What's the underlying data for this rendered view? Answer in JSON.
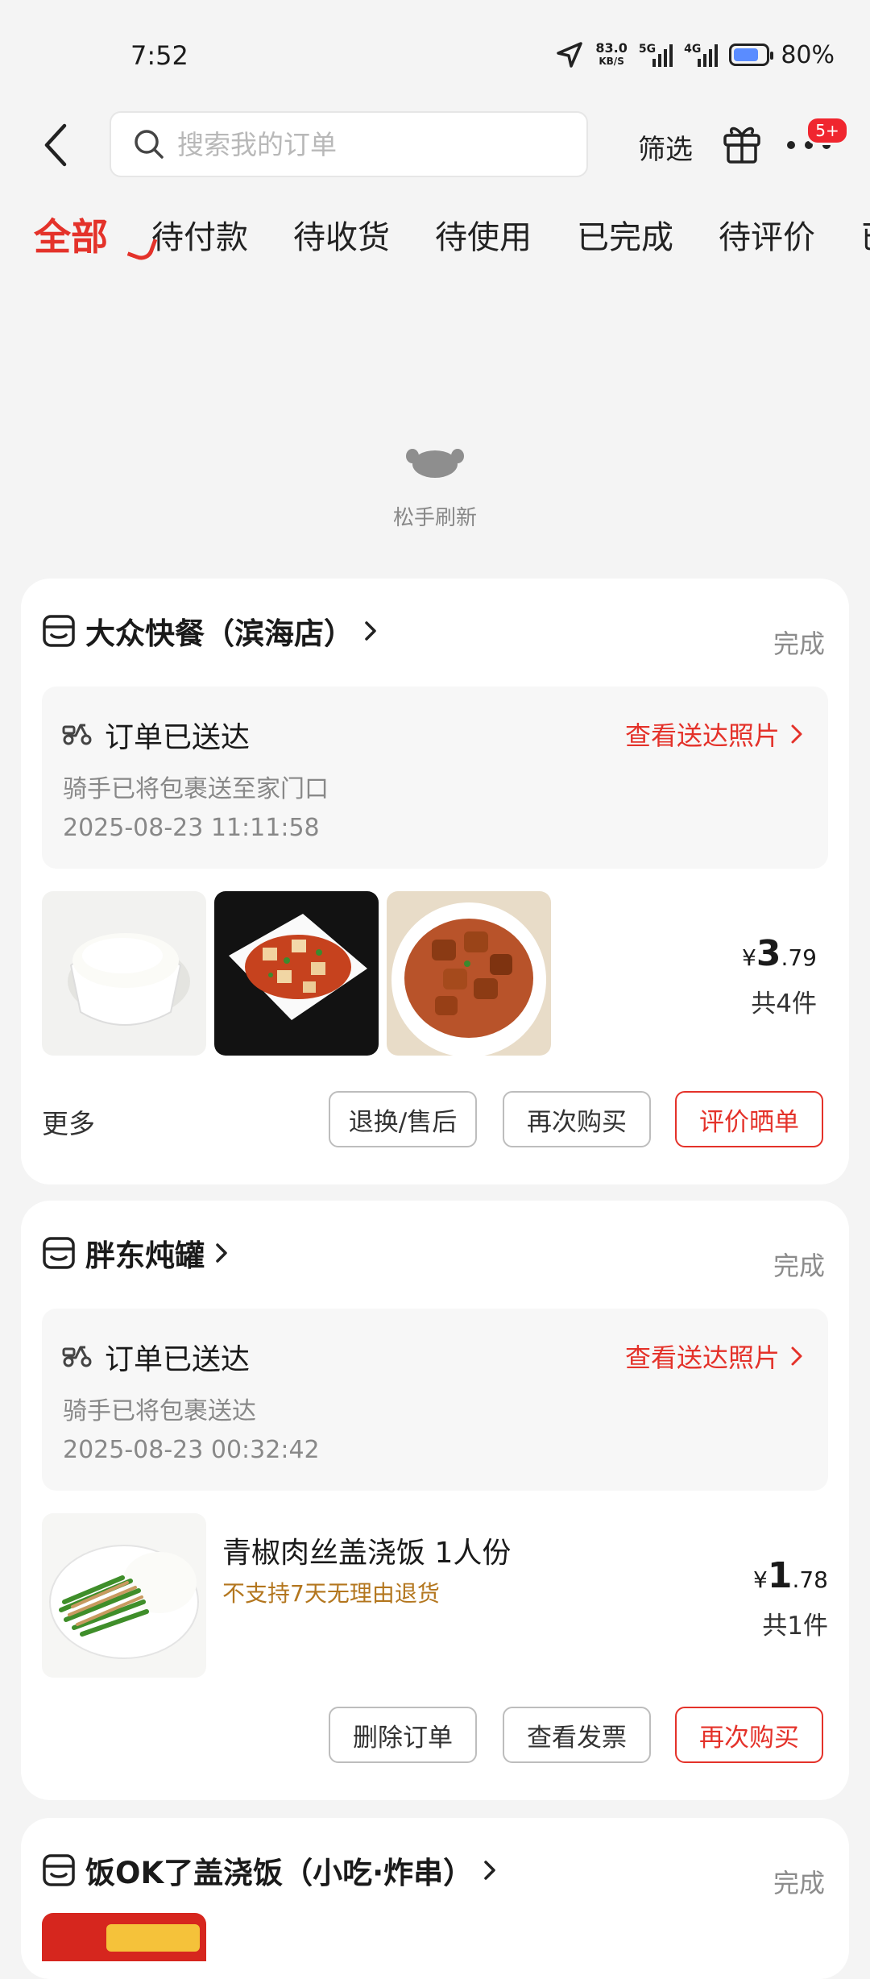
{
  "status_bar": {
    "time": "7:52",
    "net_speed": "83.0",
    "net_unit": "KB/S",
    "sig1_label": "5G",
    "sig2_label": "4G",
    "battery_level": 0.8,
    "battery_text": "80%"
  },
  "header": {
    "search_placeholder": "搜索我的订单",
    "filter_label": "筛选",
    "more_badge": "5+"
  },
  "tabs": [
    "全部",
    "待付款",
    "待收货",
    "待使用",
    "已完成",
    "待评价",
    "已"
  ],
  "active_tab": 0,
  "refresh_text": "松手刷新",
  "orders": [
    {
      "shop_name": "大众快餐（滨海店）",
      "status": "完成",
      "delivery_title": "订单已送达",
      "photo_link": "查看送达照片",
      "delivery_desc": "骑手已将包裹送至家门口",
      "delivery_time": "2025-08-23 11:11:58",
      "items": [
        "rice-bowl",
        "mapo-tofu",
        "braised-tofu"
      ],
      "price_symbol": "¥",
      "price_int": "3",
      "price_dec": ".79",
      "count": "共4件",
      "more": "更多",
      "buttons": [
        "退换/售后",
        "再次购买",
        "评价晒单"
      ]
    },
    {
      "shop_name": "胖东炖罐",
      "status": "完成",
      "delivery_title": "订单已送达",
      "photo_link": "查看送达照片",
      "delivery_desc": "骑手已将包裹送达",
      "delivery_time": "2025-08-23 00:32:42",
      "item_name": "青椒肉丝盖浇饭 1人份",
      "item_note": "不支持7天无理由退货",
      "price_symbol": "¥",
      "price_int": "1",
      "price_dec": ".78",
      "count": "共1件",
      "buttons": [
        "删除订单",
        "查看发票",
        "再次购买"
      ]
    },
    {
      "shop_name": "饭OK了盖浇饭（小吃·炸串）",
      "status": "完成"
    }
  ]
}
